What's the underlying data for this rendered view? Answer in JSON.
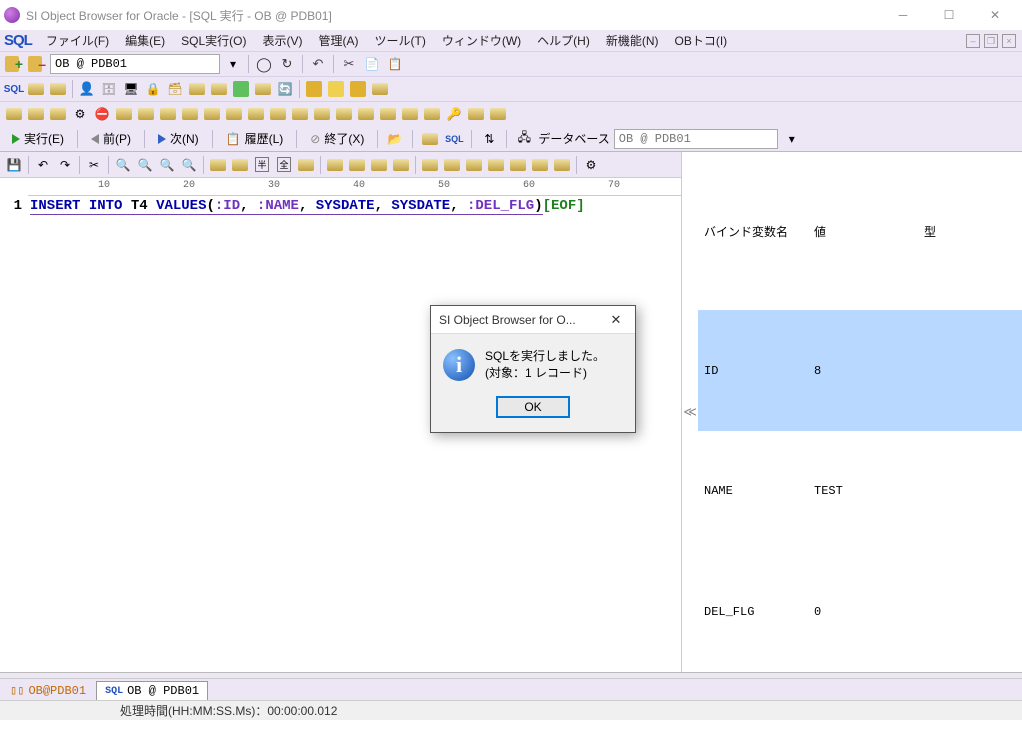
{
  "window": {
    "title": "SI Object Browser for Oracle - [SQL 実行 - OB @ PDB01]"
  },
  "menu": {
    "logo": "SQL",
    "items": [
      "ファイル(F)",
      "編集(E)",
      "SQL実行(O)",
      "表示(V)",
      "管理(A)",
      "ツール(T)",
      "ウィンドウ(W)",
      "ヘルプ(H)",
      "新機能(N)",
      "OBトコ(I)"
    ]
  },
  "toolbar1": {
    "db_combo": "OB @ PDB01"
  },
  "exec": {
    "run": "実行(E)",
    "prev": "前(P)",
    "next": "次(N)",
    "history": "履歴(L)",
    "end": "終了(X)",
    "db_label": "データベース",
    "db_combo": "OB @ PDB01"
  },
  "ruler": [
    "10",
    "20",
    "30",
    "40",
    "50",
    "60",
    "70"
  ],
  "sql": {
    "lineno": "1",
    "kw1": "INSERT",
    "kw2": "INTO",
    "tbl": "T4",
    "kw3": "VALUES",
    "bind1": ":ID",
    "bind2": ":NAME",
    "f1": "SYSDATE",
    "f2": "SYSDATE",
    "bind3": ":DEL_FLG",
    "eof": "[EOF]"
  },
  "bind": {
    "h1": "バインド変数名",
    "h2": "値",
    "h3": "型",
    "rows": [
      {
        "name": "ID",
        "val": "8",
        "type": ""
      },
      {
        "name": "NAME",
        "val": "TEST",
        "type": ""
      },
      {
        "name": "DEL_FLG",
        "val": "0",
        "type": ""
      }
    ]
  },
  "tabs": {
    "t1": "OB@PDB01",
    "t2": "OB @ PDB01"
  },
  "status": {
    "text": "処理時間(HH:MM:SS.Ms)：00:00:00.012"
  },
  "dialog": {
    "title": "SI Object Browser for O...",
    "line1": "SQLを実行しました。",
    "line2": "(対象：1 レコード)",
    "ok": "OK"
  }
}
